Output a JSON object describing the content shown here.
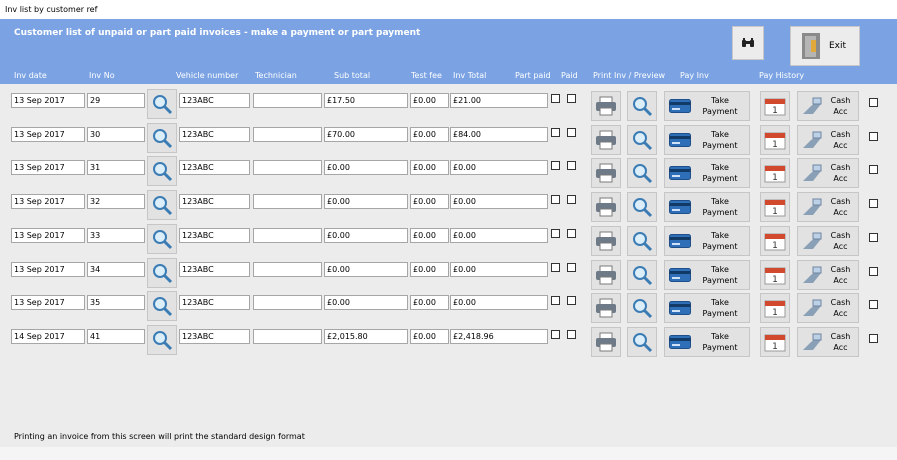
{
  "window": {
    "title": "Inv list by customer ref"
  },
  "header": {
    "title": "Customer list of unpaid or part paid invoices  - make a payment or part payment",
    "exit_label": "Exit",
    "columns": {
      "inv_date": "Inv date",
      "inv_no": "Inv No",
      "vehicle": "Vehicle number",
      "technician": "Technician",
      "subtotal": "Sub total",
      "test_fee": "Test fee",
      "inv_total": "Inv Total",
      "part_paid": "Part paid",
      "paid": "Paid",
      "print": "Print Inv / Preview",
      "pay_inv": "Pay Inv",
      "pay_history": "Pay History"
    }
  },
  "buttons": {
    "take_payment_line1": "Take",
    "take_payment_line2": "Payment",
    "cash_acc_line1": "Cash",
    "cash_acc_line2": "Acc",
    "calendar_digit": "1"
  },
  "colors": {
    "header": "#7ba3e3",
    "body": "#ececec"
  },
  "icons": [
    "binoculars-icon",
    "exit-door-icon",
    "magnifier-icon",
    "printer-icon",
    "credit-card-icon",
    "calendar-icon",
    "cash-hand-icon"
  ],
  "rows": [
    {
      "date": "13 Sep  2017",
      "no": "29",
      "vehicle": "123ABC",
      "technician": "",
      "subtotal": "£17.50",
      "test_fee": "£0.00",
      "total": "£21.00"
    },
    {
      "date": "13 Sep  2017",
      "no": "30",
      "vehicle": "123ABC",
      "technician": "",
      "subtotal": "£70.00",
      "test_fee": "£0.00",
      "total": "£84.00"
    },
    {
      "date": "13 Sep  2017",
      "no": "31",
      "vehicle": "123ABC",
      "technician": "",
      "subtotal": "£0.00",
      "test_fee": "£0.00",
      "total": "£0.00"
    },
    {
      "date": "13 Sep  2017",
      "no": "32",
      "vehicle": "123ABC",
      "technician": "",
      "subtotal": "£0.00",
      "test_fee": "£0.00",
      "total": "£0.00"
    },
    {
      "date": "13 Sep  2017",
      "no": "33",
      "vehicle": "123ABC",
      "technician": "",
      "subtotal": "£0.00",
      "test_fee": "£0.00",
      "total": "£0.00"
    },
    {
      "date": "13 Sep  2017",
      "no": "34",
      "vehicle": "123ABC",
      "technician": "",
      "subtotal": "£0.00",
      "test_fee": "£0.00",
      "total": "£0.00"
    },
    {
      "date": "13 Sep  2017",
      "no": "35",
      "vehicle": "123ABC",
      "technician": "",
      "subtotal": "£0.00",
      "test_fee": "£0.00",
      "total": "£0.00"
    },
    {
      "date": "14 Sep  2017",
      "no": "41",
      "vehicle": "123ABC",
      "technician": "",
      "subtotal": "£2,015.80",
      "test_fee": "£0.00",
      "total": "£2,418.96"
    }
  ],
  "footer": {
    "note": "Printing an invoice from this screen will print the standard design format"
  }
}
